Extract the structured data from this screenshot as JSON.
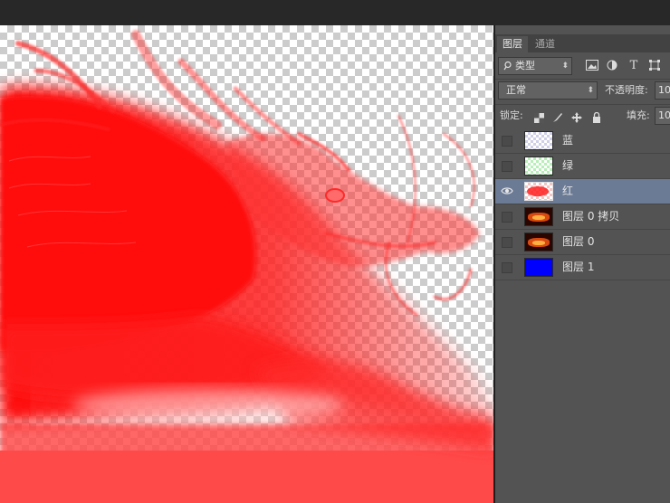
{
  "panel": {
    "tabs": [
      {
        "label": "图层"
      },
      {
        "label": "通道"
      }
    ],
    "filter": {
      "icon": "search-icon",
      "value": "类型"
    },
    "blend_mode": "正常",
    "opacity_label": "不透明度:",
    "opacity_value": "10",
    "lock_label": "锁定:",
    "fill_label": "填充:",
    "fill_value": "10"
  },
  "layers": [
    {
      "name": "蓝",
      "visible": false,
      "selected": false,
      "thumb": "blue-transparent"
    },
    {
      "name": "绿",
      "visible": false,
      "selected": false,
      "thumb": "green-transparent"
    },
    {
      "name": "红",
      "visible": true,
      "selected": true,
      "thumb": "red-transparent"
    },
    {
      "name": "图层 0 拷贝",
      "visible": false,
      "selected": false,
      "thumb": "dragon-photo"
    },
    {
      "name": "图层 0",
      "visible": false,
      "selected": false,
      "thumb": "dragon-photo"
    },
    {
      "name": "图层 1",
      "visible": false,
      "selected": false,
      "thumb": "solid-blue"
    }
  ],
  "colors": {
    "layer_selected": "#6b7b96",
    "panel_bg": "#535353",
    "canvas_tint": "#ff1a1a",
    "layer1_fill": "#0000ff"
  }
}
